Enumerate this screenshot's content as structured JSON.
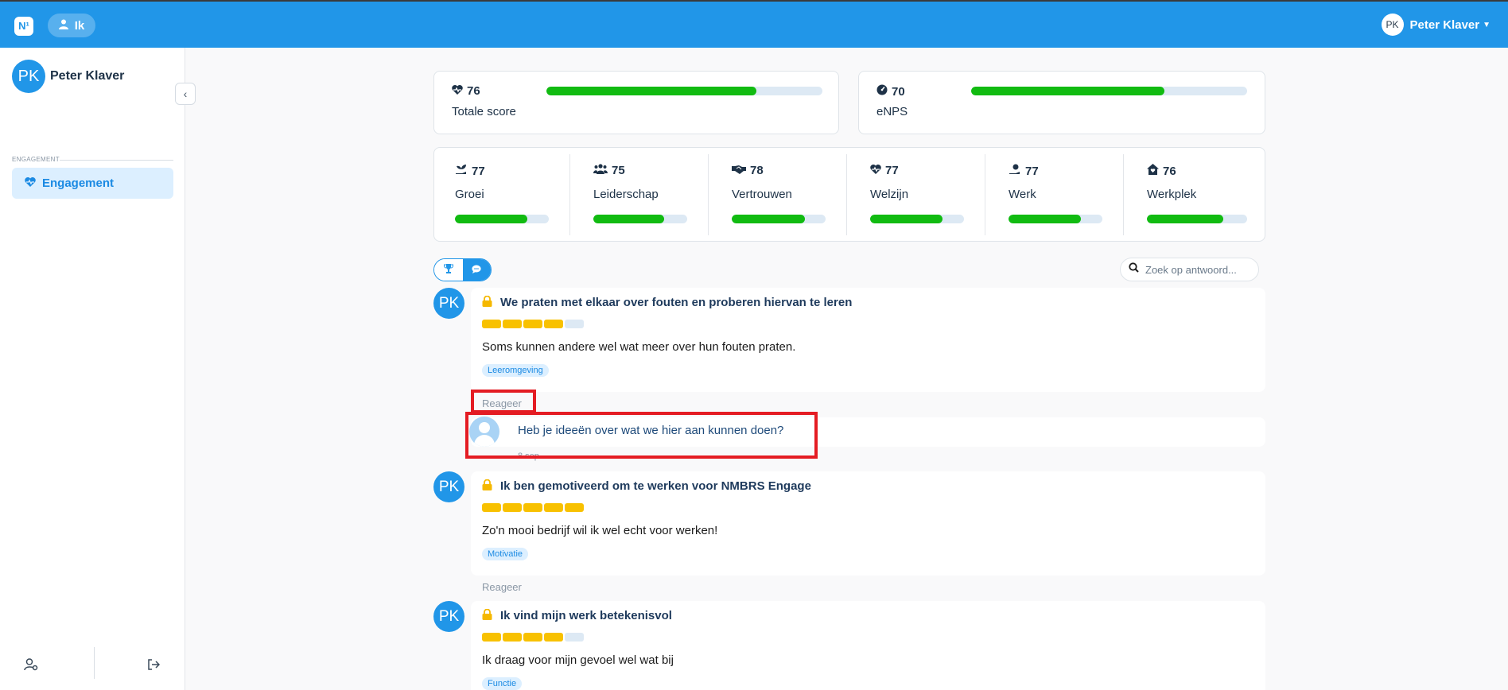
{
  "topbar": {
    "logo": "N¹",
    "ik_label": "Ik",
    "user_initials": "PK",
    "user_name": "Peter Klaver"
  },
  "sidebar": {
    "user_initials": "PK",
    "user_name": "Peter Klaver",
    "section_label": "ENGAGEMENT",
    "items": [
      {
        "label": "Engagement",
        "icon": "heartbeat-icon"
      }
    ],
    "bottom_icons": [
      "user-settings-icon",
      "logout-icon"
    ]
  },
  "scores": {
    "total": {
      "value": "76",
      "label": "Totale score",
      "fill": 0.76
    },
    "enps": {
      "value": "70",
      "label": "eNPS",
      "fill": 0.7
    },
    "themes": [
      {
        "value": "77",
        "label": "Groei",
        "fill": 0.77,
        "icon": "hand-growth-icon"
      },
      {
        "value": "75",
        "label": "Leiderschap",
        "fill": 0.75,
        "icon": "users-icon"
      },
      {
        "value": "78",
        "label": "Vertrouwen",
        "fill": 0.78,
        "icon": "handshake-icon"
      },
      {
        "value": "77",
        "label": "Welzijn",
        "fill": 0.77,
        "icon": "heartbeat-icon"
      },
      {
        "value": "77",
        "label": "Werk",
        "fill": 0.77,
        "icon": "hand-icon"
      },
      {
        "value": "76",
        "label": "Werkplek",
        "fill": 0.76,
        "icon": "house-icon"
      }
    ]
  },
  "toolbar": {
    "search_placeholder": "Zoek op antwoord..."
  },
  "feed": {
    "reply_label": "Reageer",
    "posts": [
      {
        "initials": "PK",
        "title": "We praten met elkaar over fouten en proberen hiervan te leren",
        "rating": 4,
        "text": "Soms kunnen andere wel wat meer over hun fouten praten.",
        "tag": "Leeromgeving"
      },
      {
        "initials": "PK",
        "title": "Ik ben gemotiveerd om te werken voor NMBRS Engage",
        "rating": 5,
        "text": "Zo'n mooi bedrijf wil ik wel echt voor werken!",
        "tag": "Motivatie"
      },
      {
        "initials": "PK",
        "title": "Ik vind mijn werk betekenisvol",
        "rating": 4,
        "text": "Ik draag voor mijn gevoel wel wat bij",
        "tag": "Functie"
      }
    ],
    "reply": {
      "text": "Heb je ideeën over wat we hier aan kunnen doen?",
      "time": "8 sep."
    }
  },
  "colors": {
    "primary": "#2196e8",
    "bar_fill": "#11bb11",
    "star_on": "#f8c100",
    "highlight": "#e41c23"
  }
}
